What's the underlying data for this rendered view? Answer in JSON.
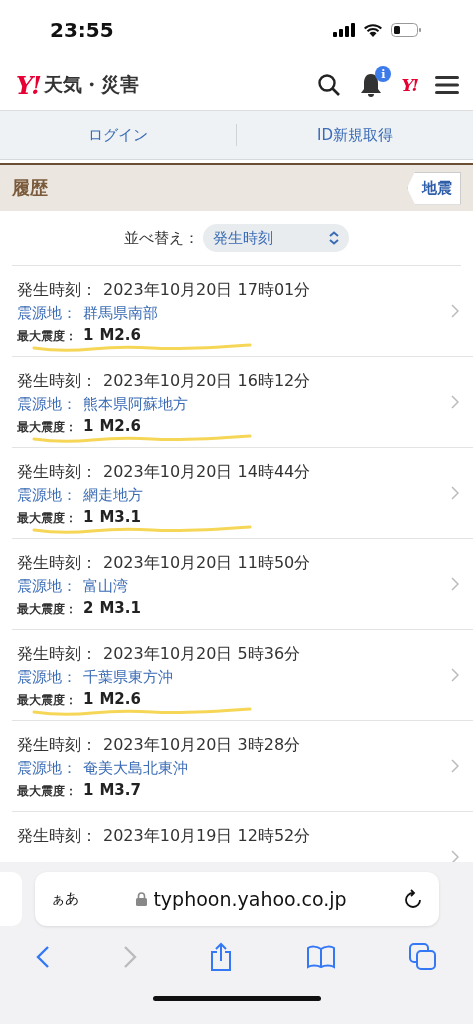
{
  "status_bar": {
    "time": "23:55"
  },
  "header": {
    "logo_mark": "Y!",
    "logo_text": "天気・災害",
    "notification_badge": "i",
    "yahoo_mark": "Y!"
  },
  "account_links": [
    "ログイン",
    "ID新規取得"
  ],
  "section": {
    "title": "履歴",
    "tag": "地震"
  },
  "sort": {
    "label": "並べ替え：",
    "value": "発生時刻"
  },
  "quakes": [
    {
      "time_label": "発生時刻：",
      "time": "2023年10月20日 17時01分",
      "place_label": "震源地：",
      "place": "群馬県南部",
      "intensity_label": "最大震度：",
      "intensity": "1",
      "magnitude": "M2.6",
      "underlined": true
    },
    {
      "time_label": "発生時刻：",
      "time": "2023年10月20日 16時12分",
      "place_label": "震源地：",
      "place": "熊本県阿蘇地方",
      "intensity_label": "最大震度：",
      "intensity": "1",
      "magnitude": "M2.6",
      "underlined": true
    },
    {
      "time_label": "発生時刻：",
      "time": "2023年10月20日 14時44分",
      "place_label": "震源地：",
      "place": "網走地方",
      "intensity_label": "最大震度：",
      "intensity": "1",
      "magnitude": "M3.1",
      "underlined": true
    },
    {
      "time_label": "発生時刻：",
      "time": "2023年10月20日 11時50分",
      "place_label": "震源地：",
      "place": "富山湾",
      "intensity_label": "最大震度：",
      "intensity": "2",
      "magnitude": "M3.1",
      "underlined": false
    },
    {
      "time_label": "発生時刻：",
      "time": "2023年10月20日 5時36分",
      "place_label": "震源地：",
      "place": "千葉県東方沖",
      "intensity_label": "最大震度：",
      "intensity": "1",
      "magnitude": "M2.6",
      "underlined": true
    },
    {
      "time_label": "発生時刻：",
      "time": "2023年10月20日 3時28分",
      "place_label": "震源地：",
      "place": "奄美大島北東沖",
      "intensity_label": "最大震度：",
      "intensity": "1",
      "magnitude": "M3.7",
      "underlined": false
    },
    {
      "time_label": "発生時刻：",
      "time": "2023年10月19日 12時52分",
      "underlined": false
    }
  ],
  "browser": {
    "text_size": "ぁあ",
    "url": "typhoon.yahoo.co.jp"
  }
}
